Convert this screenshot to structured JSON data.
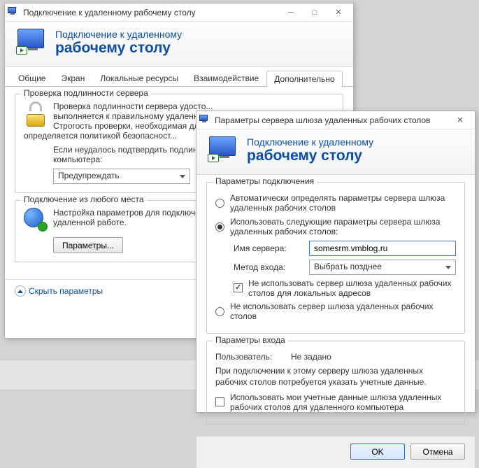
{
  "win1": {
    "title": "Подключение к удаленному рабочему столу",
    "banner_line1": "Подключение к удаленному",
    "banner_line2": "рабочему столу",
    "tabs": [
      "Общие",
      "Экран",
      "Локальные ресурсы",
      "Взаимодействие",
      "Дополнительно"
    ],
    "group_auth": {
      "title": "Проверка подлинности сервера",
      "desc1": "Проверка подлинности сервера удосто...",
      "desc2": "выполняется к правильному удаленном...",
      "desc3": "Строгость проверки, необходимая для...",
      "desc4": "определяется политикой безопасност...",
      "desc5": "Если неудалось подтвердить подлинн...",
      "desc6": "компьютера:",
      "combo_value": "Предупреждать"
    },
    "group_anywhere": {
      "title": "Подключение из любого места",
      "desc1": "Настройка параметров для подключен...",
      "desc2": "удаленной работе.",
      "button": "Параметры..."
    },
    "hide_link": "Скрыть параметры"
  },
  "win2": {
    "title": "Параметры сервера шлюза удаленных рабочих столов",
    "banner_line1": "Подключение к удаленному",
    "banner_line2": "рабочему столу",
    "group_conn": {
      "title": "Параметры подключения",
      "opt_auto": "Автоматически определять параметры сервера шлюза удаленных рабочих столов",
      "opt_use": "Использовать следующие параметры сервера шлюза удаленных рабочих столов:",
      "server_label": "Имя сервера:",
      "server_value": "somesrm.vmblog.ru",
      "method_label": "Метод входа:",
      "method_value": "Выбрать позднее",
      "chk_bypass": "Не использовать сервер шлюза удаленных рабочих столов для локальных адресов",
      "opt_none": "Не использовать сервер шлюза удаленных рабочих столов"
    },
    "group_login": {
      "title": "Параметры входа",
      "user_label": "Пользователь:",
      "user_value": "Не задано",
      "desc": "При подключении к этому серверу шлюза удаленных рабочих столов потребуется указать учетные данные.",
      "chk_creds": "Использовать мои учетные данные шлюза удаленных рабочих столов для удаленного компьютера"
    },
    "ok": "OK",
    "cancel": "Отмена"
  }
}
